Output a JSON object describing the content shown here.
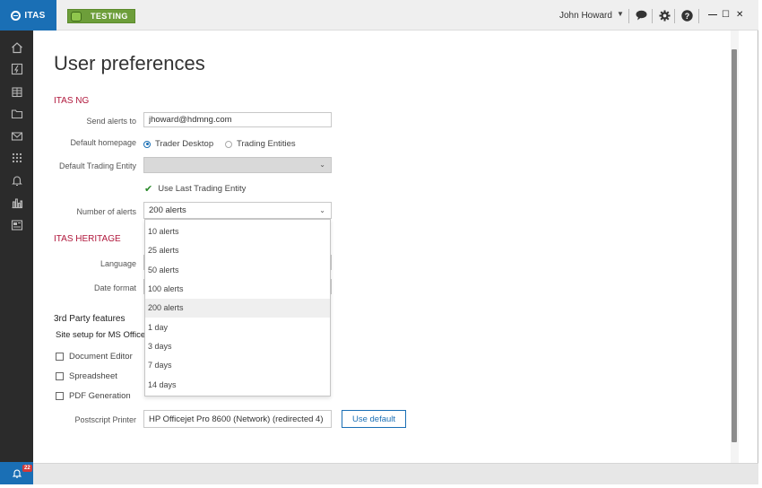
{
  "app": {
    "logo_text": "ITAS",
    "environment": "TESTING"
  },
  "header": {
    "user_name": "John Howard",
    "minimize": "—",
    "maximize": "☐",
    "close": "✕"
  },
  "page": {
    "title": "User preferences"
  },
  "itas_ng": {
    "section_label": "ITAS NG",
    "send_alerts_label": "Send alerts to",
    "send_alerts_value": "jhoward@hdmng.com",
    "default_homepage_label": "Default homepage",
    "homepage_options": [
      "Trader Desktop",
      "Trading Entities"
    ],
    "homepage_selected": "Trader Desktop",
    "default_trading_entity_label": "Default Trading Entity",
    "use_last_trading_entity": "Use Last Trading Entity",
    "number_of_alerts_label": "Number of alerts",
    "number_of_alerts_value": "200 alerts"
  },
  "alerts_dropdown": {
    "options": [
      "10 alerts",
      "25 alerts",
      "50 alerts",
      "100 alerts",
      "200 alerts",
      "1 day",
      "3 days",
      "7 days",
      "14 days"
    ],
    "highlighted": "200 alerts"
  },
  "itas_heritage": {
    "section_label": "ITAS HERITAGE",
    "language_label": "Language",
    "date_format_label": "Date format"
  },
  "third_party": {
    "section_label": "3rd Party features",
    "site_setup_label": "Site setup for MS Office",
    "checkboxes": [
      "Document Editor",
      "Spreadsheet",
      "PDF Generation"
    ],
    "postscript_label": "Postscript Printer",
    "postscript_value": "HP Officejet Pro 8600 (Network) (redirected 4)",
    "use_default_label": "Use default"
  },
  "notifications": {
    "badge_count": "22"
  },
  "colors": {
    "brand": "#1a6fb5",
    "accent": "#b0183c",
    "environment": "#6d9e3a",
    "sidebar": "#2b2b2b"
  }
}
